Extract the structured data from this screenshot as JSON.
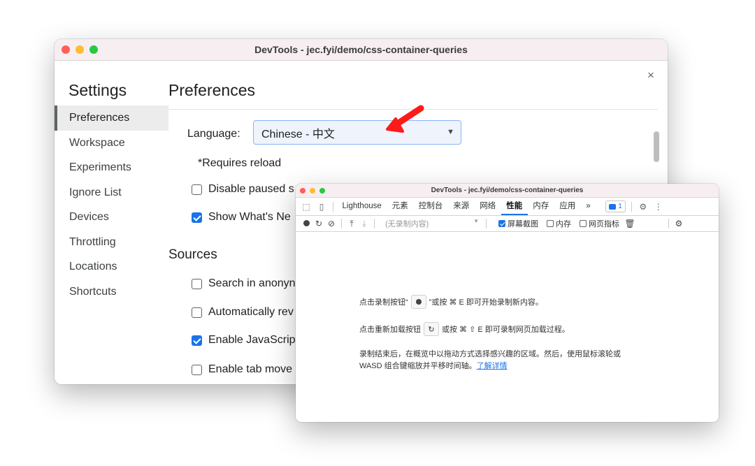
{
  "settings_window": {
    "title": "DevTools - jec.fyi/demo/css-container-queries",
    "close_glyph": "×",
    "settings_heading": "Settings",
    "sidebar": {
      "items": [
        "Preferences",
        "Workspace",
        "Experiments",
        "Ignore List",
        "Devices",
        "Throttling",
        "Locations",
        "Shortcuts"
      ],
      "active_index": 0
    },
    "preferences_heading": "Preferences",
    "language": {
      "label": "Language:",
      "value": "Chinese - 中文"
    },
    "requires_reload": "*Requires reload",
    "appearance_options": [
      {
        "label": "Disable paused s",
        "checked": false
      },
      {
        "label": "Show What's Ne",
        "checked": true
      }
    ],
    "sources_heading": "Sources",
    "sources_options": [
      {
        "label": "Search in anonyn",
        "checked": false
      },
      {
        "label": "Automatically rev",
        "checked": false
      },
      {
        "label": "Enable JavaScrip",
        "checked": true
      },
      {
        "label": "Enable tab move",
        "checked": false
      }
    ]
  },
  "annotation": {
    "arrow_color": "#ff1a1a",
    "icon": "red-arrow-icon"
  },
  "devtools_window": {
    "title": "DevTools - jec.fyi/demo/css-container-queries",
    "tabs": [
      "Lighthouse",
      "元素",
      "控制台",
      "来源",
      "网络",
      "性能",
      "内存",
      "应用"
    ],
    "active_tab": "性能",
    "more_tabs_glyph": "»",
    "issues_count": "1",
    "profile_select": "(无录制内容)",
    "options": {
      "screenshots": {
        "label": "屏幕截图",
        "checked": true
      },
      "memory": {
        "label": "内存",
        "checked": false
      },
      "web_vitals": {
        "label": "网页指标",
        "checked": false
      }
    },
    "hint_record": {
      "before": "点击录制按钮“",
      "after": "”或按 ⌘ E 即可开始录制新内容。"
    },
    "hint_reload": {
      "before": "点击重新加载按钮",
      "after": "或按 ⌘ ⇧ E 即可录制网页加载过程。"
    },
    "hint_after_line1": "录制结束后，在概览中以拖动方式选择感兴趣的区域。然后，使用鼠标滚轮或",
    "hint_after_line2": "WASD 组合键缩放并平移时间轴。",
    "learn_more": "了解详情"
  },
  "colors": {
    "accent": "#1a73e8",
    "titlebar": "#f6eef0"
  }
}
